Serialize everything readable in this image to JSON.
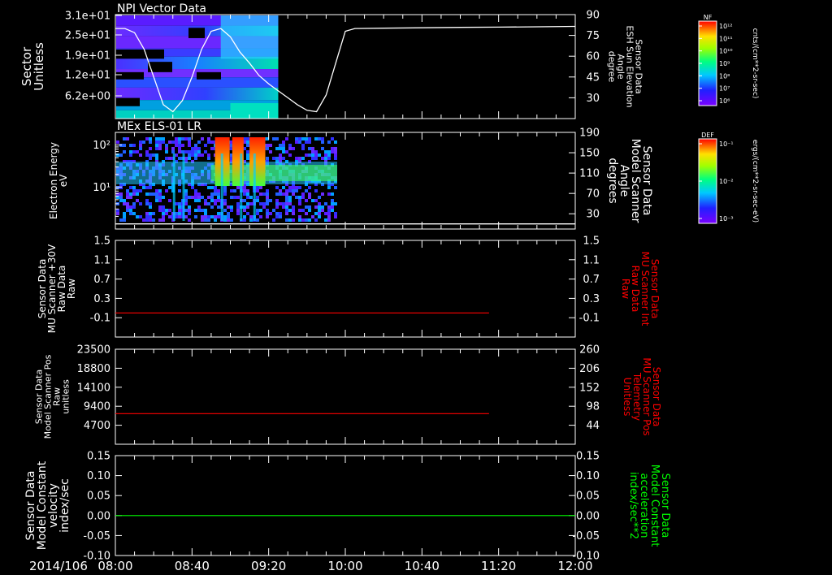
{
  "chart_data": [
    {
      "type": "heatmap",
      "title": "NPI Vector Data",
      "left_axis": {
        "labels": [
          "Sector",
          "Unitless"
        ],
        "ticks": [
          "3.1e+01",
          "2.5e+01",
          "1.9e+01",
          "1.2e+01",
          "6.2e+00"
        ],
        "ylim": [
          0,
          31
        ]
      },
      "right_axis": {
        "labels": [
          "Sensor Data",
          "ESH Sun Elevation",
          "Angle",
          "degree"
        ],
        "ticks": [
          "90",
          "75",
          "60",
          "45",
          "30"
        ],
        "ylim": [
          15,
          90
        ]
      },
      "colorbar": {
        "title": "NF",
        "unit": "cnts/(cm**2-sr-sec)",
        "ticks": [
          "10¹²",
          "10¹¹",
          "10¹⁰",
          "10⁹",
          "10⁸",
          "10⁷",
          "10⁶"
        ]
      },
      "sun_elevation_series": {
        "color": "#ffffff",
        "x": [
          "08:00",
          "08:05",
          "08:10",
          "08:15",
          "08:20",
          "08:25",
          "08:30",
          "08:35",
          "08:40",
          "08:45",
          "08:50",
          "08:55",
          "09:00",
          "09:05",
          "09:10",
          "09:15",
          "09:20",
          "09:25",
          "09:30",
          "09:35",
          "09:40",
          "09:45",
          "09:50",
          "09:55",
          "10:00",
          "10:05",
          "10:20",
          "10:40",
          "11:00",
          "11:20",
          "11:40",
          "12:00"
        ],
        "y": [
          80,
          80,
          77,
          65,
          45,
          25,
          20,
          28,
          45,
          65,
          78,
          80,
          74,
          63,
          55,
          46,
          40,
          35,
          30,
          25,
          21,
          20,
          32,
          55,
          78,
          80,
          80.2,
          80.5,
          80.8,
          81,
          81.2,
          81.5
        ]
      }
    },
    {
      "type": "heatmap",
      "title": "MEx ELS-01 LR",
      "left_axis": {
        "labels": [
          "Electron Energy",
          "eV"
        ],
        "ticks": [
          "10²",
          "10¹"
        ],
        "scale": "log",
        "ylim": [
          1,
          200
        ]
      },
      "right_axis": {
        "labels": [
          "Sensor Data",
          "Model Scanner",
          "Angle",
          "degrees"
        ],
        "ticks": [
          "190",
          "150",
          "110",
          "70",
          "30"
        ],
        "ylim": [
          0,
          190
        ]
      },
      "colorbar": {
        "title": "DEF",
        "unit": "ergs/(cm**2-sr-sec-eV)",
        "ticks": [
          "10⁻¹",
          "10⁻²",
          "10⁻³"
        ]
      },
      "scanner_angle_series": {
        "color": "#ffffff",
        "x": [
          "08:00",
          "12:00"
        ],
        "y": [
          10,
          10
        ]
      }
    },
    {
      "type": "line",
      "left_axis": {
        "labels": [
          "Sensor Data",
          "MU Scanner +30V",
          "Raw Data",
          "Raw"
        ],
        "ticks": [
          "1.5",
          "1.1",
          "0.7",
          "0.3",
          "-0.1"
        ],
        "ylim": [
          -0.5,
          1.5
        ]
      },
      "right_axis": {
        "labels": [
          "Sensor Data",
          "MU Scanner Int",
          "Raw Data",
          "Raw"
        ],
        "ticks": [
          "1.5",
          "1.1",
          "0.7",
          "0.3",
          "-0.1"
        ],
        "ylim": [
          -0.5,
          1.5
        ],
        "color": "#ff0000"
      },
      "series": [
        {
          "color": "#ff0000",
          "x": [
            "08:00",
            "11:15"
          ],
          "y": [
            0.0,
            0.0
          ]
        }
      ]
    },
    {
      "type": "line",
      "left_axis": {
        "labels": [
          "Sensor Data",
          "Model Scanner Pos",
          "Raw",
          "unitless"
        ],
        "ticks": [
          "23500",
          "18800",
          "14100",
          "9400",
          "4700"
        ],
        "ylim": [
          0,
          23500
        ]
      },
      "right_axis": {
        "labels": [
          "Sensor Data",
          "MU Scanner Pos",
          "Telemetry",
          "Unitless"
        ],
        "ticks": [
          "260",
          "206",
          "152",
          "98",
          "44"
        ],
        "ylim": [
          -10,
          260
        ],
        "color": "#ff0000"
      },
      "series": [
        {
          "color": "#ff0000",
          "x": [
            "08:00",
            "11:15"
          ],
          "y": [
            77,
            77
          ]
        }
      ]
    },
    {
      "type": "line",
      "left_axis": {
        "labels": [
          "Sensor Data",
          "Model Constant",
          "velocity",
          "index/sec"
        ],
        "ticks": [
          "0.15",
          "0.10",
          "0.05",
          "0.00",
          "-0.05",
          "-0.10"
        ],
        "ylim": [
          -0.1,
          0.15
        ]
      },
      "right_axis": {
        "labels": [
          "Sensor Data",
          "Model Constant",
          "acceleration",
          "index/sec**2"
        ],
        "ticks": [
          "0.15",
          "0.10",
          "0.05",
          "0.00",
          "-0.05",
          "-0.10"
        ],
        "ylim": [
          -0.1,
          0.15
        ],
        "color": "#00ff00"
      },
      "series": [
        {
          "color": "#00ff00",
          "x": [
            "08:00",
            "12:00"
          ],
          "y": [
            0.0,
            0.0
          ]
        }
      ]
    }
  ],
  "time_axis": {
    "date": "2014/106",
    "ticks": [
      "08:00",
      "08:40",
      "09:20",
      "10:00",
      "10:40",
      "11:20",
      "12:00"
    ],
    "range": [
      "08:00",
      "12:00"
    ]
  }
}
